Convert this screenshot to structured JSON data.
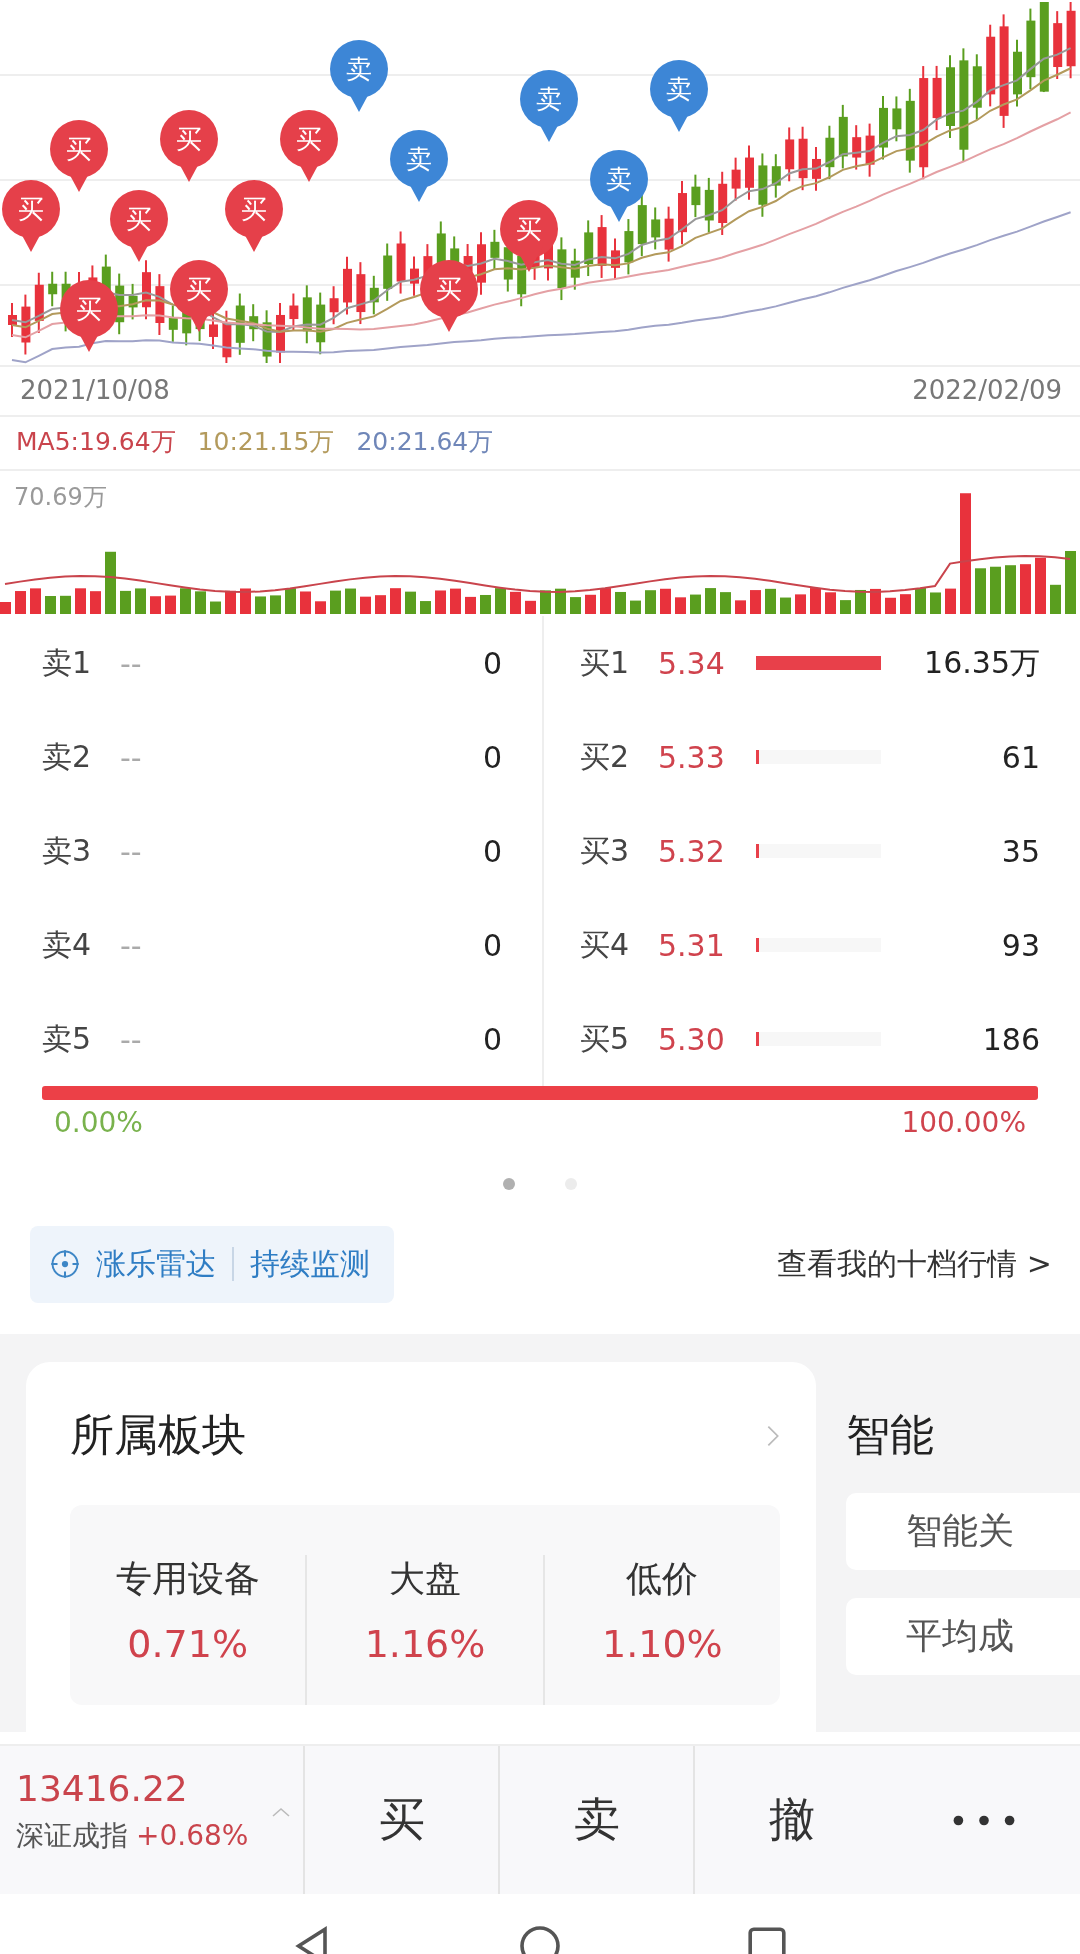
{
  "kline": {
    "start_date": "2021/10/08",
    "end_date": "2022/02/09",
    "markers": [
      {
        "kind": "buy",
        "label": "买"
      },
      {
        "kind": "buy",
        "label": "买"
      },
      {
        "kind": "buy",
        "label": "买"
      },
      {
        "kind": "buy",
        "label": "买"
      },
      {
        "kind": "buy",
        "label": "买"
      },
      {
        "kind": "buy",
        "label": "买"
      },
      {
        "kind": "buy",
        "label": "买"
      },
      {
        "kind": "buy",
        "label": "买"
      },
      {
        "kind": "sell",
        "label": "卖"
      },
      {
        "kind": "sell",
        "label": "卖"
      },
      {
        "kind": "buy",
        "label": "买"
      },
      {
        "kind": "buy",
        "label": "买"
      },
      {
        "kind": "sell",
        "label": "卖"
      },
      {
        "kind": "sell",
        "label": "卖"
      },
      {
        "kind": "sell",
        "label": "卖"
      }
    ]
  },
  "ma_legend": [
    {
      "text": "MA5:19.64万",
      "color": "#c9444c"
    },
    {
      "text": "10:21.15万",
      "color": "#b39a5c"
    },
    {
      "text": "20:21.64万",
      "color": "#6f86b8"
    }
  ],
  "volume": {
    "max_label": "70.69万"
  },
  "asks": [
    {
      "label": "卖1",
      "price": "--",
      "volume": "0"
    },
    {
      "label": "卖2",
      "price": "--",
      "volume": "0"
    },
    {
      "label": "卖3",
      "price": "--",
      "volume": "0"
    },
    {
      "label": "卖4",
      "price": "--",
      "volume": "0"
    },
    {
      "label": "卖5",
      "price": "--",
      "volume": "0"
    }
  ],
  "bids": [
    {
      "label": "买1",
      "price": "5.34",
      "volume": "16.35万",
      "level": 1
    },
    {
      "label": "买2",
      "price": "5.33",
      "volume": "61",
      "level": 0.01
    },
    {
      "label": "买3",
      "price": "5.32",
      "volume": "35",
      "level": 0.01
    },
    {
      "label": "买4",
      "price": "5.31",
      "volume": "93",
      "level": 0.01
    },
    {
      "label": "买5",
      "price": "5.30",
      "volume": "186",
      "level": 0.01
    }
  ],
  "ratio": {
    "sell_pct": "0.00%",
    "buy_pct": "100.00%",
    "level": 1
  },
  "pages": [
    {
      "selected": true
    },
    {
      "selected": false
    }
  ],
  "radar": {
    "title": "涨乐雷达",
    "action": "持续监测"
  },
  "ten_level_link": "查看我的十档行情 >",
  "sector_card": {
    "title": "所属板块",
    "items": [
      {
        "name": "专用设备",
        "change": "0.71%"
      },
      {
        "name": "大盘",
        "change": "1.16%"
      },
      {
        "name": "低价",
        "change": "1.10%"
      }
    ]
  },
  "smart_card": {
    "title": "智能",
    "rows": [
      "智能关",
      "平均成"
    ]
  },
  "bottom_bar": {
    "index_value": "13416.22",
    "index_name": "深证成指",
    "index_change": "+0.68%",
    "buttons": [
      "买",
      "卖",
      "撤"
    ]
  }
}
